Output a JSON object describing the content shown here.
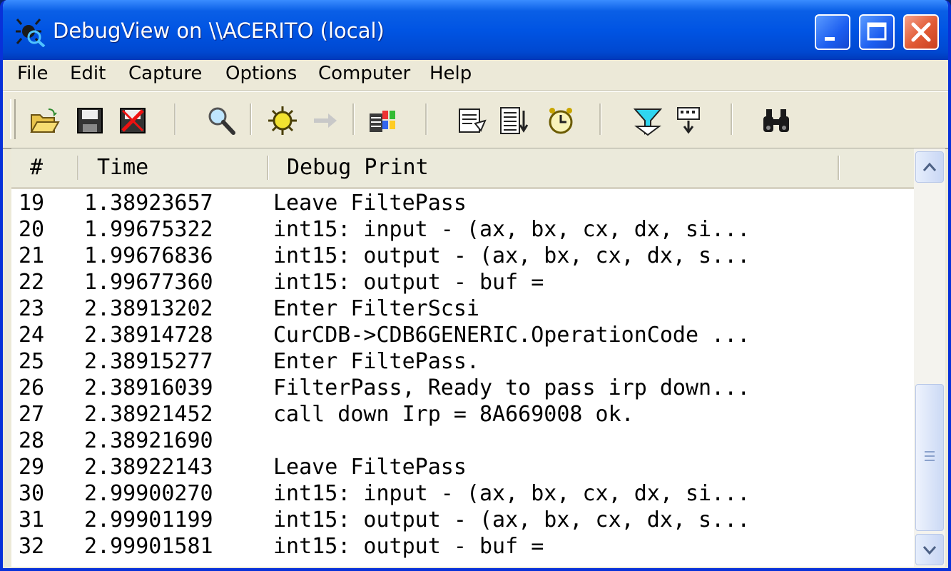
{
  "window": {
    "title": "DebugView on \\\\ACERITO (local)"
  },
  "menu": [
    "File",
    "Edit",
    "Capture",
    "Options",
    "Computer",
    "Help"
  ],
  "toolbar": [
    "open-folder-icon",
    "save-icon",
    "clear-display-icon",
    "find-icon",
    "capture-icon",
    "forward-icon",
    "capture-win32-icon",
    "history-depth-icon",
    "autoscroll-icon",
    "clock-time-icon",
    "filter-highlight-icon",
    "filter-icon",
    "find-binoculars-icon"
  ],
  "columns": {
    "num": "#",
    "time": "Time",
    "print": "Debug Print"
  },
  "rows": [
    {
      "num": "19",
      "time": "1.38923657",
      "msg": "Leave FiltePass"
    },
    {
      "num": "20",
      "time": "1.99675322",
      "msg": "int15: input - (ax, bx, cx, dx, si..."
    },
    {
      "num": "21",
      "time": "1.99676836",
      "msg": "int15: output - (ax, bx, cx, dx, s..."
    },
    {
      "num": "22",
      "time": "1.99677360",
      "msg": "int15: output - buf ="
    },
    {
      "num": "23",
      "time": "2.38913202",
      "msg": "Enter FilterScsi"
    },
    {
      "num": "24",
      "time": "2.38914728",
      "msg": "CurCDB->CDB6GENERIC.OperationCode ..."
    },
    {
      "num": "25",
      "time": "2.38915277",
      "msg": "Enter FiltePass."
    },
    {
      "num": "26",
      "time": "2.38916039",
      "msg": "FilterPass, Ready to pass irp down..."
    },
    {
      "num": "27",
      "time": "2.38921452",
      "msg": "call down Irp = 8A669008 ok."
    },
    {
      "num": "28",
      "time": "2.38921690",
      "msg": ""
    },
    {
      "num": "29",
      "time": "2.38922143",
      "msg": "Leave FiltePass"
    },
    {
      "num": "30",
      "time": "2.99900270",
      "msg": "int15: input - (ax, bx, cx, dx, si..."
    },
    {
      "num": "31",
      "time": "2.99901199",
      "msg": "int15: output - (ax, bx, cx, dx, s..."
    },
    {
      "num": "32",
      "time": "2.99901581",
      "msg": "int15: output - buf ="
    }
  ]
}
